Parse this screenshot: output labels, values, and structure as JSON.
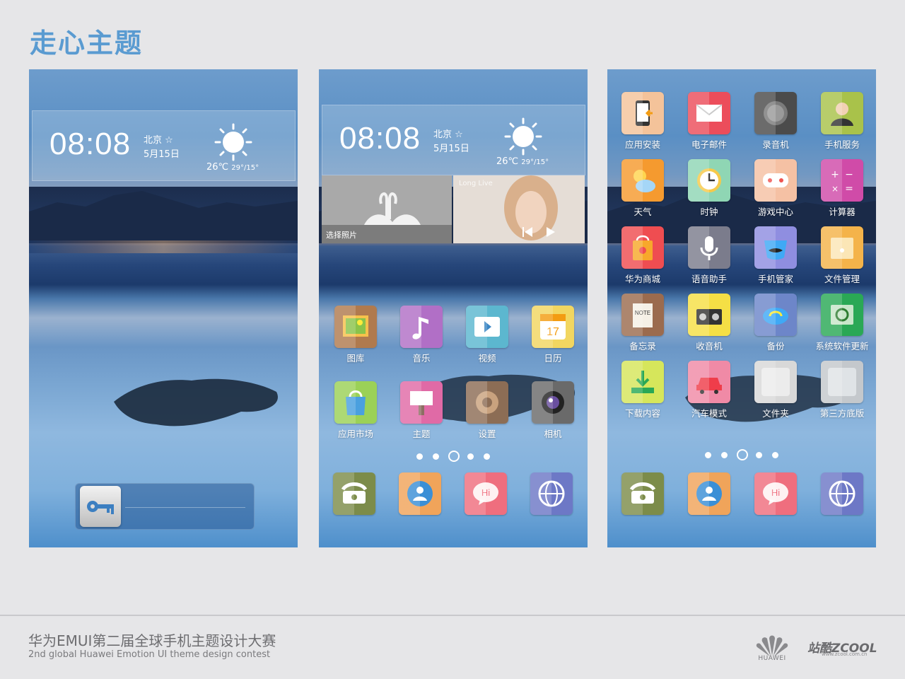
{
  "header": {
    "title": "走心主题"
  },
  "lockscreen": {
    "time": "08:08",
    "city": "北京 ☆",
    "date": "5月15日",
    "temp_main": "26℃",
    "temp_range": "29°/15°"
  },
  "home1": {
    "time": "08:08",
    "city": "北京 ☆",
    "date": "5月15日",
    "temp_main": "26℃",
    "temp_range": "29°/15°",
    "photo_label": "选择照片",
    "music_label": "Long Live",
    "apps": [
      {
        "label": "图库",
        "icon": "gallery-icon",
        "color": "#b07a4e"
      },
      {
        "label": "音乐",
        "icon": "music-icon",
        "color": "#b16fc6"
      },
      {
        "label": "视频",
        "icon": "video-icon",
        "color": "#5cb7cf"
      },
      {
        "label": "日历",
        "icon": "calendar-icon",
        "color": "#f2d660"
      },
      {
        "label": "应用市场",
        "icon": "app-market-icon",
        "color": "#9bd157"
      },
      {
        "label": "主题",
        "icon": "theme-icon",
        "color": "#e06aa6"
      },
      {
        "label": "设置",
        "icon": "settings-icon",
        "color": "#8c6d55"
      },
      {
        "label": "相机",
        "icon": "camera-icon",
        "color": "#6a6a6a"
      }
    ],
    "dock": [
      {
        "icon": "phone-icon",
        "color": "#7c8c4a"
      },
      {
        "icon": "contacts-icon",
        "color": "#f0a45a"
      },
      {
        "icon": "messages-icon",
        "color": "#ef6e7e"
      },
      {
        "icon": "browser-icon",
        "color": "#6d78c6"
      }
    ]
  },
  "home2": {
    "apps": [
      {
        "label": "应用安装",
        "icon": "app-install-icon",
        "color": "#f4c39a"
      },
      {
        "label": "电子邮件",
        "icon": "email-icon",
        "color": "#ec4d5b"
      },
      {
        "label": "录音机",
        "icon": "recorder-icon",
        "color": "#4b4b4b"
      },
      {
        "label": "手机服务",
        "icon": "phone-service-icon",
        "color": "#a9c24a"
      },
      {
        "label": "天气",
        "icon": "weather-icon",
        "color": "#f59a2f"
      },
      {
        "label": "时钟",
        "icon": "clock-icon",
        "color": "#8fd6b4"
      },
      {
        "label": "游戏中心",
        "icon": "game-center-icon",
        "color": "#f5c1a4"
      },
      {
        "label": "计算器",
        "icon": "calculator-icon",
        "color": "#d04ba8"
      },
      {
        "label": "华为商城",
        "icon": "huawei-store-icon",
        "color": "#ef4d51"
      },
      {
        "label": "语音助手",
        "icon": "voice-assistant-icon",
        "color": "#7b7c8c"
      },
      {
        "label": "手机管家",
        "icon": "phone-manager-icon",
        "color": "#8f8ee0"
      },
      {
        "label": "文件管理",
        "icon": "file-manager-icon",
        "color": "#f4b34a"
      },
      {
        "label": "备忘录",
        "icon": "memo-icon",
        "color": "#9b6b4e"
      },
      {
        "label": "收音机",
        "icon": "radio-icon",
        "color": "#f5df45"
      },
      {
        "label": "备份",
        "icon": "backup-icon",
        "color": "#6d86c9"
      },
      {
        "label": "系统软件更新",
        "icon": "system-update-icon",
        "color": "#2aa855"
      },
      {
        "label": "下载内容",
        "icon": "downloads-icon",
        "color": "#d6e65b"
      },
      {
        "label": "汽车模式",
        "icon": "car-mode-icon",
        "color": "#f08aa6"
      },
      {
        "label": "文件夹",
        "icon": "folder-icon",
        "color": "#d8d8d8"
      },
      {
        "label": "第三方底版",
        "icon": "third-party-base-icon",
        "color": "#c4c8cc"
      }
    ],
    "dock": [
      {
        "icon": "phone-icon",
        "color": "#7c8c4a"
      },
      {
        "icon": "contacts-icon",
        "color": "#f0a45a"
      },
      {
        "icon": "messages-icon",
        "color": "#ef6e7e"
      },
      {
        "icon": "browser-icon",
        "color": "#6d78c6"
      }
    ]
  },
  "footer": {
    "title_cn": "华为EMUI第二届全球手机主题设计大赛",
    "subtitle_en": "2nd global Huawei Emotion UI theme design contest",
    "brand": "HUAWEI",
    "zcool": "站酷ZCOOL",
    "zcool_url": "www.zcool.com.cn"
  }
}
